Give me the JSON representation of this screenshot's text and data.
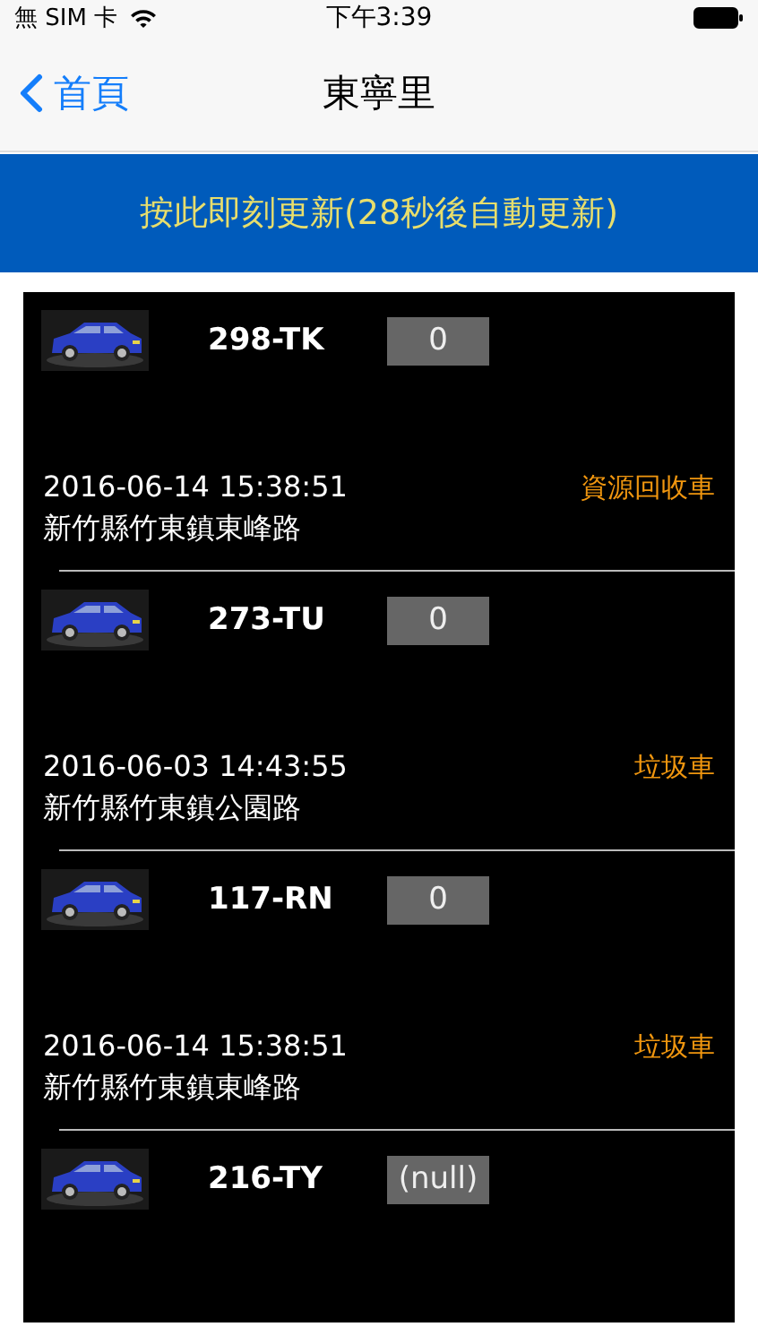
{
  "status_bar": {
    "carrier": "無 SIM 卡",
    "time": "下午3:39"
  },
  "nav": {
    "back": "首頁",
    "title": "東寧里"
  },
  "refresh_banner": "按此即刻更新(28秒後自動更新)",
  "vehicles": [
    {
      "plate": "298-TK",
      "count": "0",
      "time": "2016-06-14 15:38:51",
      "type": "資源回收車",
      "address": "新竹縣竹東鎮東峰路"
    },
    {
      "plate": "273-TU",
      "count": "0",
      "time": "2016-06-03 14:43:55",
      "type": "垃圾車",
      "address": "新竹縣竹東鎮公園路"
    },
    {
      "plate": "117-RN",
      "count": "0",
      "time": "2016-06-14 15:38:51",
      "type": "垃圾車",
      "address": "新竹縣竹東鎮東峰路"
    },
    {
      "plate": "216-TY",
      "count": "(null)"
    }
  ]
}
